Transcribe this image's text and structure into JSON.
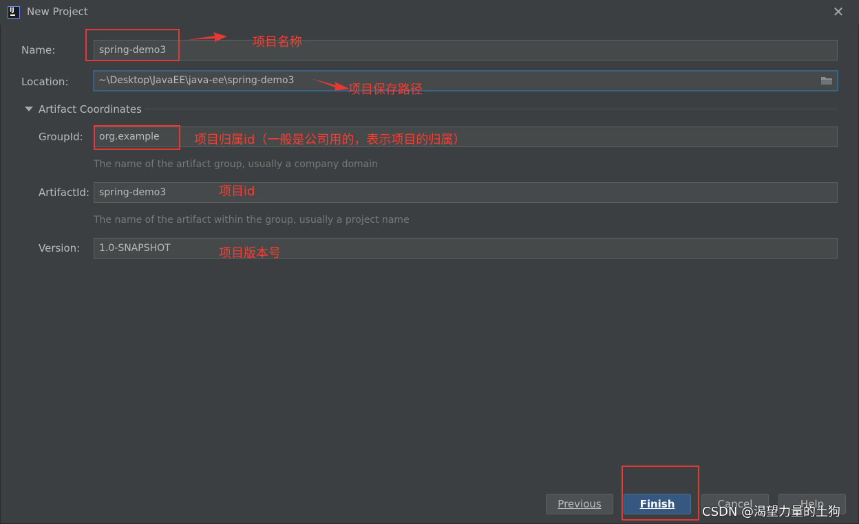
{
  "window": {
    "title": "New Project",
    "close_glyph": "✕"
  },
  "form": {
    "name": {
      "label": "Name:",
      "value": "spring-demo3"
    },
    "location": {
      "label": "Location:",
      "value": "~\\Desktop\\JavaEE\\java-ee\\spring-demo3"
    },
    "section": {
      "label": "Artifact Coordinates",
      "expanded": true
    },
    "group_id": {
      "label": "GroupId:",
      "value": "org.example",
      "hint": "The name of the artifact group, usually a company domain"
    },
    "artifact_id": {
      "label": "ArtifactId:",
      "value": "spring-demo3",
      "hint": "The name of the artifact within the group, usually a project name"
    },
    "version": {
      "label": "Version:",
      "value": "1.0-SNAPSHOT"
    }
  },
  "buttons": {
    "previous": "Previous",
    "finish": "Finish",
    "cancel": "Cancel",
    "help": "Help"
  },
  "annotations": {
    "name": "项目名称",
    "location": "项目保存路径",
    "group_id": "项目归属id（一般是公司用的，表示项目的归属）",
    "artifact_id": "项目id",
    "version": "项目版本号"
  },
  "watermark": "CSDN @渴望力量的土狗",
  "colors": {
    "background": "#3c3f41",
    "field": "#45494a",
    "focus": "#3d6185",
    "default_button": "#365880",
    "annotation": "#ff3b30"
  },
  "icons": {
    "app": "intellij-idea-icon",
    "close": "close-icon",
    "folder": "folder-icon",
    "section": "triangle-down-icon"
  }
}
